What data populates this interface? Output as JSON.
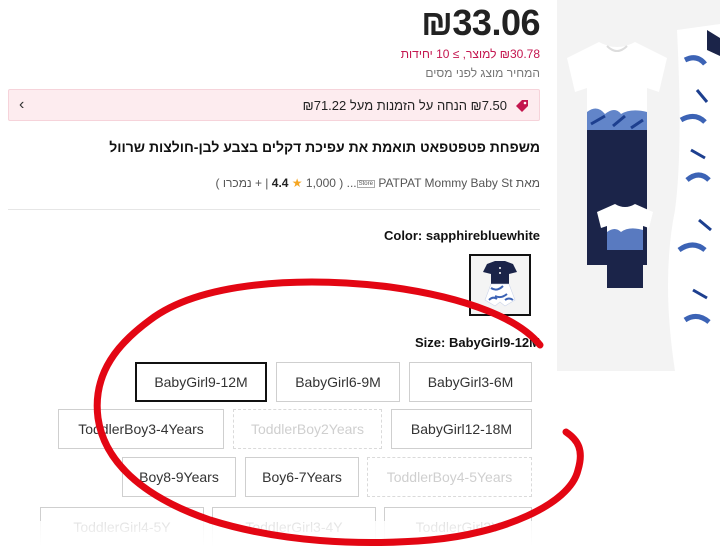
{
  "price": {
    "main": "₪33.06"
  },
  "unit_price": "₪30.78 למוצר, ≥ 10 יחידות",
  "tax_note": "המחיר מוצג לפני מסים",
  "coupon": {
    "text": "₪7.50 הנחה על הזמנות מעל ₪71.22"
  },
  "product": {
    "title": "משפחת פטפטפאט תואמת את עפיכת דקלים בצבע לבן-חולצות שרוול"
  },
  "store": {
    "prefix": "מאת",
    "name": "PATPAT Mommy Baby St...",
    "ext_label": "Store",
    "rating": "4.4",
    "reviews": "1,000",
    "sold": "+ נמכרו"
  },
  "color": {
    "label": "Color: sapphirebluewhite"
  },
  "size": {
    "label": "Size: BabyGirl9-12M",
    "options": [
      {
        "label": "BabyGirl9-12M",
        "state": "selected"
      },
      {
        "label": "BabyGirl6-9M",
        "state": "available"
      },
      {
        "label": "BabyGirl3-6M",
        "state": "available"
      },
      {
        "label": "ToddlerBoy3-4Years",
        "state": "available"
      },
      {
        "label": "ToddlerBoy2Years",
        "state": "disabled"
      },
      {
        "label": "BabyGirl12-18M",
        "state": "available"
      },
      {
        "label": "Boy8-9Years",
        "state": "available"
      },
      {
        "label": "Boy6-7Years",
        "state": "available"
      },
      {
        "label": "ToddlerBoy4-5Years",
        "state": "disabled"
      },
      {
        "label": "ToddlerGirl4-5Y",
        "state": "available"
      },
      {
        "label": "ToddlerGirl3-4Y",
        "state": "available"
      },
      {
        "label": "ToddlerGirl2Y",
        "state": "available"
      }
    ]
  },
  "colors": {
    "accent_red": "#c4164f",
    "coupon_bg": "#fdecef",
    "annotation_red": "#e30613",
    "navy": "#1b2449",
    "leaf_blue": "#3c63b5"
  },
  "icons": {
    "coupon": "price-tag-icon",
    "chevron": "chevron-left-icon",
    "star": "star-icon"
  }
}
